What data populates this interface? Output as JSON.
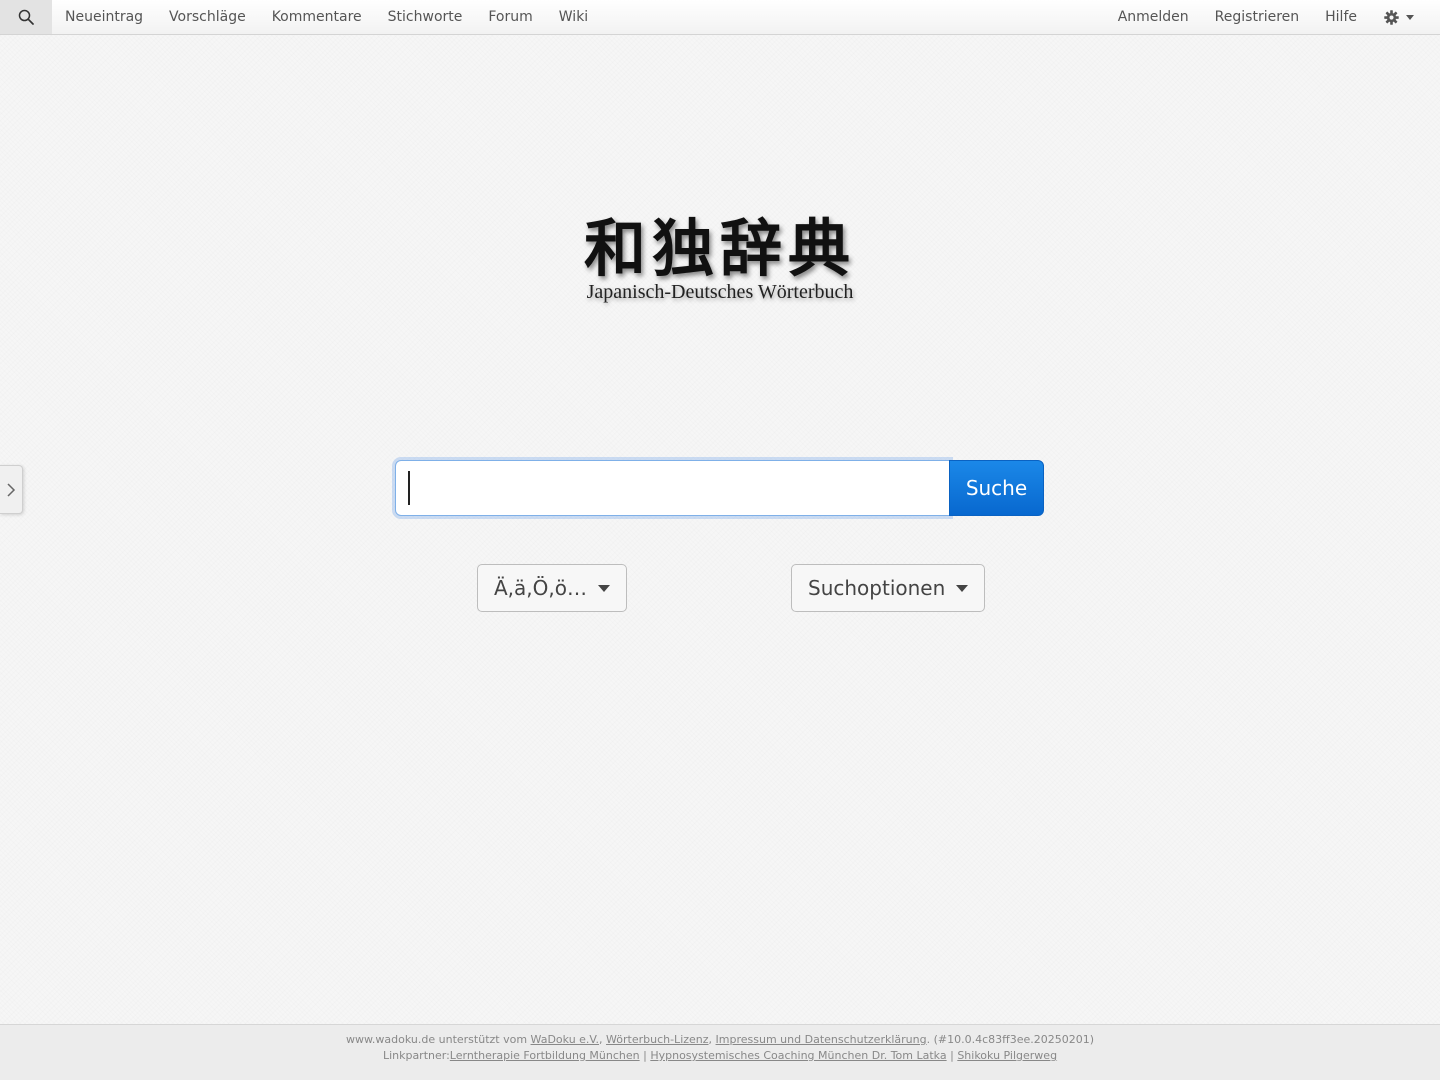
{
  "navbar": {
    "search_icon": "search-icon",
    "left_items": [
      "Neueintrag",
      "Vorschläge",
      "Kommentare",
      "Stichworte",
      "Forum",
      "Wiki"
    ],
    "right_items": [
      "Anmelden",
      "Registrieren",
      "Hilfe"
    ],
    "settings_icon": "gear-icon"
  },
  "sidebar_toggle": {
    "icon": "chevron-right-icon"
  },
  "logo": {
    "cjk": "和独辞典",
    "subtitle": "Japanisch-Deutsches Wörterbuch"
  },
  "search": {
    "input_value": "",
    "button_label": "Suche"
  },
  "dropdowns": {
    "umlaut_label": "Ä,ä,Ö,ö…",
    "options_label": "Suchoptionen"
  },
  "footer": {
    "line1_prefix": "www.wadoku.de unterstützt vom ",
    "link_wadoku": "WaDoku e.V.",
    "sep1": ", ",
    "link_license": "Wörterbuch-Lizenz",
    "sep2": ", ",
    "link_impressum": "Impressum und Datenschutzerklärung",
    "version": ". (#10.0.4c83ff3ee.20250201)",
    "line2_prefix": "Linkpartner:",
    "link_partner1": "Lerntherapie Fortbildung München",
    "pipe1": " | ",
    "link_partner2": "Hypnosystemisches Coaching München Dr. Tom Latka",
    "pipe2": " | ",
    "link_partner3": "Shikoku Pilgerweg"
  },
  "colors": {
    "accent": "#0a72db",
    "input_focus": "#7fb0e8"
  }
}
